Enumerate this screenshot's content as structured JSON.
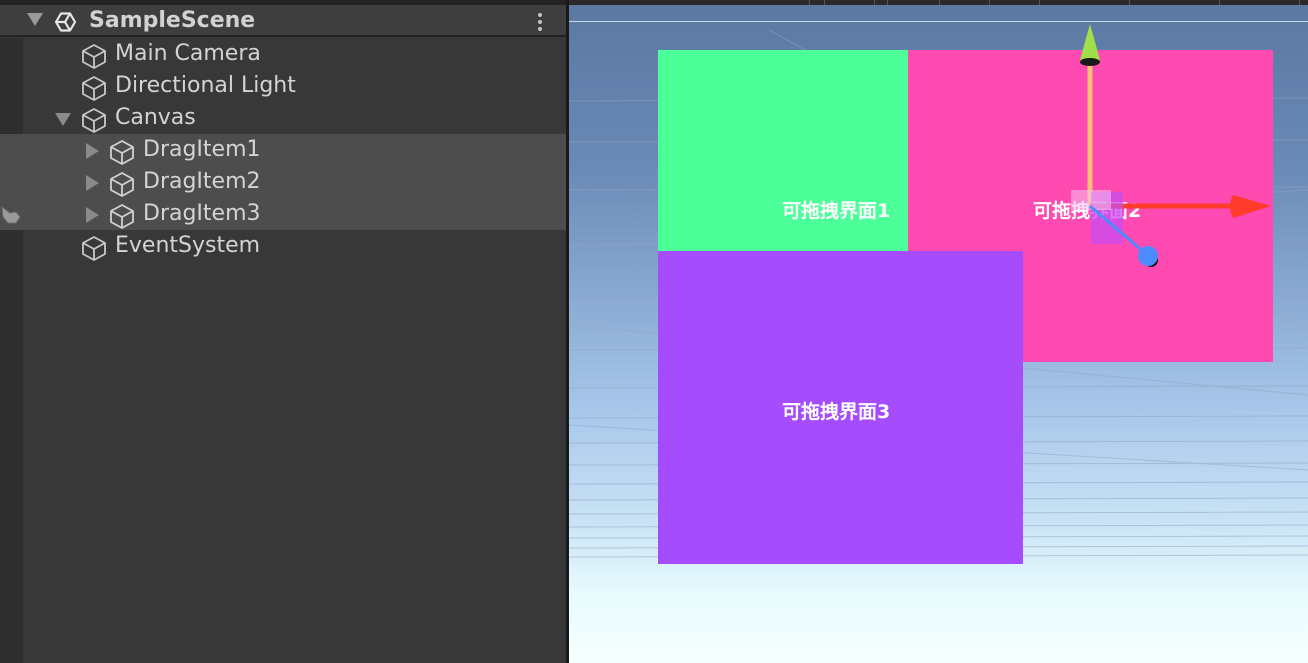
{
  "hierarchy": {
    "scene_title": "SampleScene",
    "items": [
      {
        "label": "Main Camera"
      },
      {
        "label": "Directional Light"
      },
      {
        "label": "Canvas"
      },
      {
        "label": "DragItem1"
      },
      {
        "label": "DragItem2"
      },
      {
        "label": "DragItem3"
      },
      {
        "label": "EventSystem"
      }
    ]
  },
  "scene": {
    "panels": [
      {
        "label": "可拖拽界面1",
        "color": "#4cff98"
      },
      {
        "label": "可拖拽界面2",
        "color": "#ff4ab1"
      },
      {
        "label": "可拖拽界面3",
        "color": "#a54cff"
      }
    ],
    "gizmo_colors": {
      "x_axis": "#ff3b2b",
      "y_axis": "#9fe04a",
      "z_axis": "#4c8cff",
      "y_line": "#f2c27a"
    }
  },
  "icons": [
    "unity-logo-icon",
    "more-vertical-icon",
    "gameobject-cube-icon",
    "expand-arrow-icon",
    "collapse-arrow-icon",
    "drag-hand-cursor-icon",
    "move-tool-gizmo-icon"
  ]
}
